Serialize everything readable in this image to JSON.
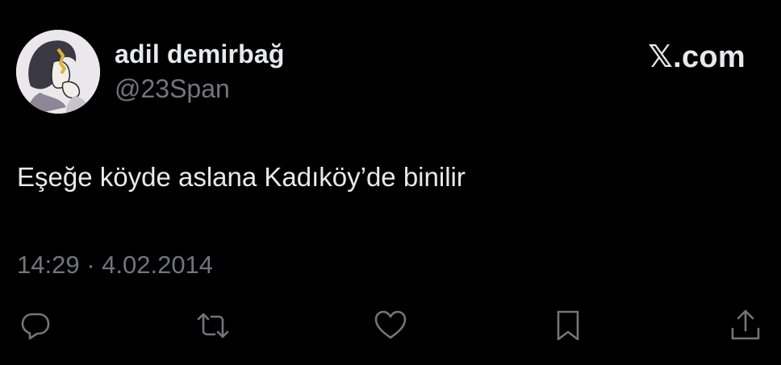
{
  "author": {
    "display_name": "adil demirbağ",
    "handle": "@23Span"
  },
  "brand": {
    "label": "𝕏.com"
  },
  "tweet": {
    "text": "Eşeğe köyde aslana Kadıköy’de binilir",
    "timestamp": "14:29 · 4.02.2014"
  },
  "actions": {
    "icons": [
      "reply-icon",
      "retweet-icon",
      "like-icon",
      "bookmark-icon",
      "share-icon"
    ]
  },
  "colors": {
    "background": "#000000",
    "primary_text": "#e7e9ea",
    "secondary_text": "#71767b"
  }
}
